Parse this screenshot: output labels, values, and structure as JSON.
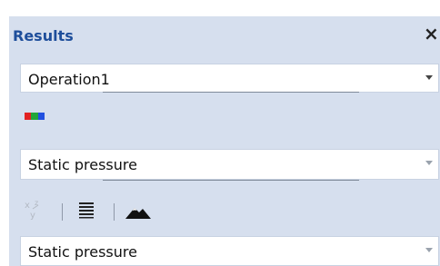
{
  "panel": {
    "title": "Results",
    "close_glyph": "×",
    "colors": {
      "header_bg": "#d6dfee",
      "title_text": "#1e4e9b"
    }
  },
  "operation_select": {
    "value": "Operation1"
  },
  "color_map_icon": {
    "icon": "rgb-color-map-icon",
    "colors": [
      "#e22222",
      "#22a63a",
      "#2250e0"
    ]
  },
  "quantity_select_top": {
    "value": "Static pressure"
  },
  "toolbar": {
    "items": [
      {
        "icon": "xyz-coordinates-icon",
        "enabled": false
      },
      {
        "icon": "list-lines-icon",
        "enabled": true
      },
      {
        "icon": "mountain-terrain-icon",
        "enabled": true
      }
    ]
  },
  "quantity_select_bottom": {
    "value": "Static pressure"
  }
}
